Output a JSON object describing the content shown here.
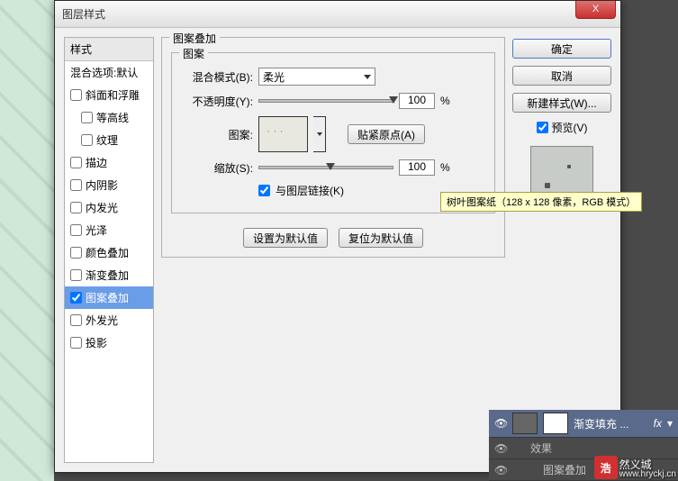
{
  "dialog": {
    "title": "图层样式",
    "close": "X"
  },
  "styles_panel": {
    "header": "样式",
    "blend_options": "混合选项:默认",
    "items": {
      "bevel": "斜面和浮雕",
      "contour": "等高线",
      "texture": "纹理",
      "stroke": "描边",
      "inner_shadow": "内阴影",
      "inner_glow": "内发光",
      "satin": "光泽",
      "color_overlay": "颜色叠加",
      "gradient_overlay": "渐变叠加",
      "pattern_overlay": "图案叠加",
      "outer_glow": "外发光",
      "drop_shadow": "投影"
    }
  },
  "center": {
    "group_title": "图案叠加",
    "subgroup_title": "图案",
    "blend_mode_label": "混合模式(B):",
    "blend_mode_value": "柔光",
    "opacity_label": "不透明度(Y):",
    "opacity_value": "100",
    "percent": "%",
    "pattern_label": "图案:",
    "snap_origin": "贴紧原点(A)",
    "scale_label": "缩放(S):",
    "scale_value": "100",
    "link_layer": "与图层链接(K)",
    "make_default": "设置为默认值",
    "reset_default": "复位为默认值",
    "tooltip": "树叶图案纸（128 x 128 像素，RGB 模式）"
  },
  "right": {
    "ok": "确定",
    "cancel": "取消",
    "new_style": "新建样式(W)...",
    "preview": "预览(V)"
  },
  "layers": {
    "layer_name": "渐变填充 ...",
    "fx": "fx",
    "effects": "效果",
    "pattern_overlay": "图案叠加"
  },
  "watermark": {
    "badge": "浩",
    "text": "然义城",
    "url": "www.hryckj.cn"
  }
}
